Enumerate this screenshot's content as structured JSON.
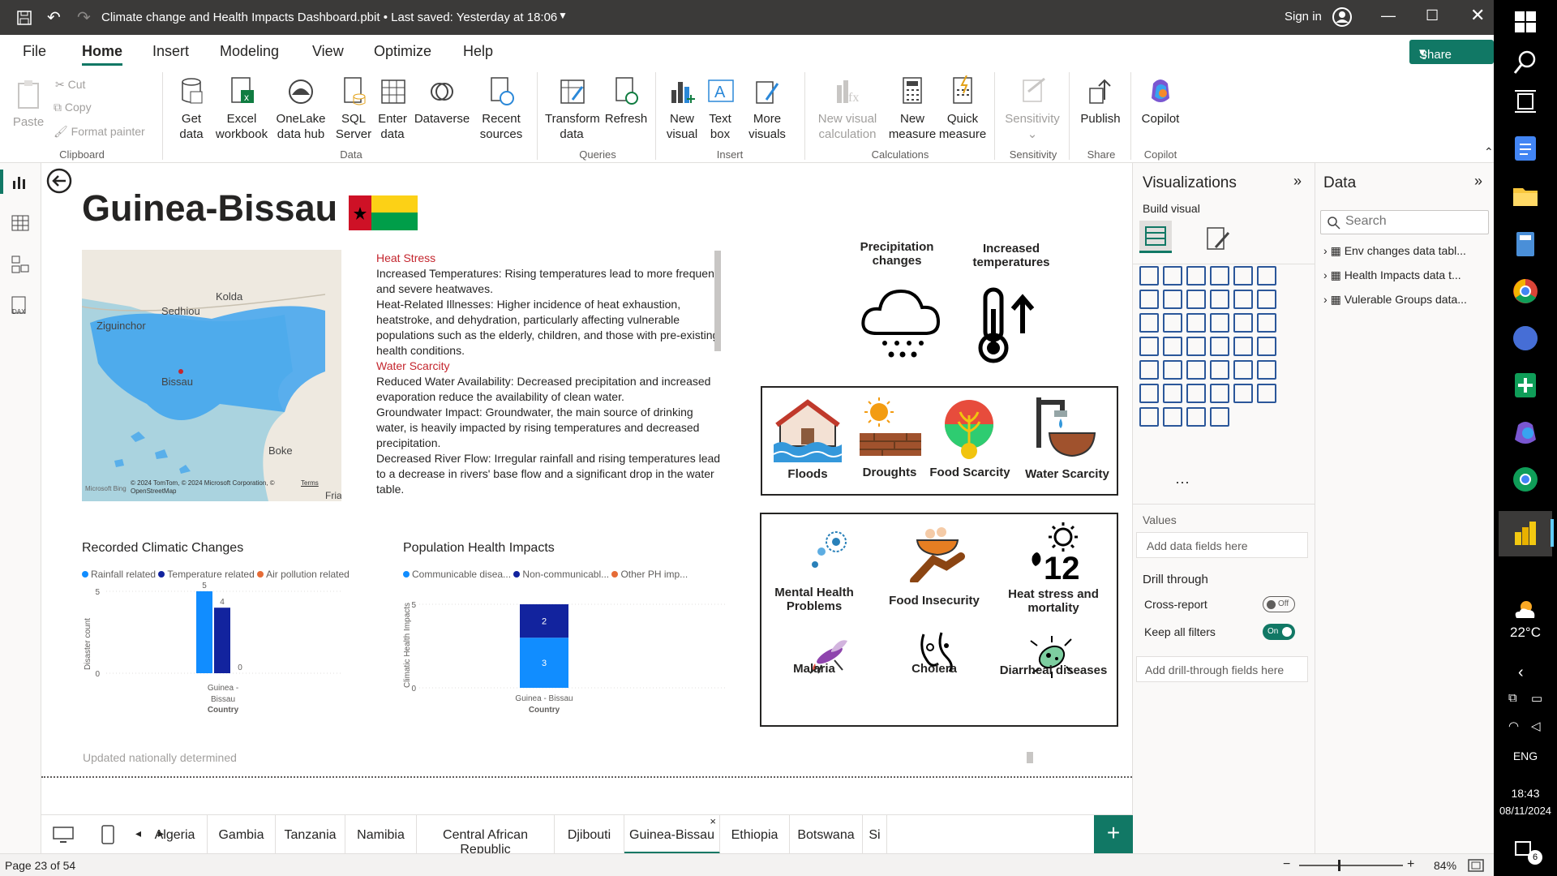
{
  "window": {
    "title": "Climate change and Health Impacts Dashboard.pbit  •  Last saved: Yesterday at 18:06",
    "sign_in": "Sign in"
  },
  "menu": {
    "file": "File",
    "home": "Home",
    "insert": "Insert",
    "modeling": "Modeling",
    "view": "View",
    "optimize": "Optimize",
    "help": "Help",
    "share": "Share"
  },
  "ribbon": {
    "paste": "Paste",
    "cut": "Cut",
    "copy": "Copy",
    "format_painter": "Format painter",
    "clipboard": "Clipboard",
    "get_data": "Get data",
    "excel": "Excel workbook",
    "onelake": "OneLake data hub",
    "sql": "SQL Server",
    "enter_data": "Enter data",
    "dataverse": "Dataverse",
    "recent": "Recent sources",
    "data_group": "Data",
    "transform": "Transform data",
    "refresh": "Refresh",
    "queries": "Queries",
    "new_visual": "New visual",
    "text_box": "Text box",
    "more_visuals": "More visuals",
    "insert_group": "Insert",
    "new_visual_calc": "New visual calculation",
    "new_measure": "New measure",
    "quick_measure": "Quick measure",
    "calculations": "Calculations",
    "sensitivity": "Sensitivity",
    "sensitivity_group": "Sensitivity",
    "publish": "Publish",
    "share_group": "Share",
    "copilot": "Copilot",
    "copilot_group": "Copilot"
  },
  "report": {
    "country": "Guinea-Bissau",
    "map_labels": {
      "kolda": "Kolda",
      "sedhiou": "Sedhiou",
      "ziguinchor": "Ziguinchor",
      "bissau": "Bissau",
      "boke": "Boke",
      "fria": "Fria"
    },
    "map_copyright": "© 2024 TomTom, © 2024 Microsoft Corporation, © OpenStreetMap",
    "map_terms": "Terms",
    "map_brand": "Microsoft Bing",
    "text": {
      "h1": "Heat Stress",
      "p1": "Increased Temperatures: Rising temperatures lead to more frequent and severe heatwaves.",
      "p2": "Heat-Related Illnesses: Higher incidence of heat exhaustion, heatstroke, and dehydration, particularly affecting vulnerable populations such as the elderly, children, and those with pre-existing health conditions.",
      "h2": "Water Scarcity",
      "p3": "Reduced Water Availability: Decreased precipitation and increased evaporation reduce the availability of clean water.",
      "p4": "Groundwater Impact: Groundwater, the main source of drinking water, is heavily impacted by rising temperatures and decreased precipitation.",
      "p5": "Decreased River Flow: Irregular rainfall and rising temperatures lead to a decrease in rivers' base flow and a significant drop in the water table."
    },
    "icons_top": {
      "precip": "Precipitation changes",
      "temps": "Increased temperatures"
    },
    "hazards": {
      "floods": "Floods",
      "droughts": "Droughts",
      "food": "Food Scarcity",
      "water": "Water Scarcity"
    },
    "health": {
      "mental": "Mental Health Problems",
      "food_insec": "Food Insecurity",
      "heat": "Heat stress and mortality",
      "malaria": "Malaria",
      "cholera": "Cholera",
      "diarrheal": "Diarrheal diseases"
    },
    "footer_note": "Updated nationally determined"
  },
  "chart_data": [
    {
      "type": "bar",
      "title": "Recorded Climatic Changes",
      "categories": [
        "Guinea - Bissau"
      ],
      "series": [
        {
          "name": "Rainfall related",
          "values": [
            5
          ],
          "color": "#118dff"
        },
        {
          "name": "Temperature related",
          "values": [
            4
          ],
          "color": "#12239e"
        },
        {
          "name": "Air pollution related",
          "values": [
            0
          ],
          "color": "#e66c37"
        }
      ],
      "xlabel": "Country",
      "ylabel": "Disaster count",
      "yticks": [
        "0",
        "5"
      ],
      "ylim": [
        0,
        5
      ]
    },
    {
      "type": "bar",
      "stacked": true,
      "title": "Population Health Impacts",
      "categories": [
        "Guinea - Bissau"
      ],
      "series": [
        {
          "name": "Communicable disea...",
          "values": [
            3
          ],
          "color": "#118dff"
        },
        {
          "name": "Non-communicabl...",
          "values": [
            2
          ],
          "color": "#12239e"
        },
        {
          "name": "Other PH imp...",
          "values": [
            0
          ],
          "color": "#e66c37"
        }
      ],
      "xlabel": "Country",
      "ylabel": "Climatic Health Impacts",
      "yticks": [
        "0",
        "5"
      ],
      "ylim": [
        0,
        5
      ]
    }
  ],
  "viz": {
    "title": "Visualizations",
    "build": "Build visual",
    "values": "Values",
    "add_fields": "Add data fields here",
    "drill": "Drill through",
    "cross": "Cross-report",
    "cross_state": "Off",
    "keep": "Keep all filters",
    "keep_state": "On",
    "add_drill": "Add drill-through fields here"
  },
  "data_pane": {
    "title": "Data",
    "search_placeholder": "Search",
    "tables": [
      "Env changes data tabl...",
      "Health Impacts data t...",
      "Vulerable Groups data..."
    ]
  },
  "tabs": [
    "Algeria",
    "Gambia",
    "Tanzania",
    "Namibia",
    "Central African Republic",
    "Djibouti",
    "Guinea-Bissau",
    "Ethiopia",
    "Botswana",
    "Si"
  ],
  "status": {
    "page": "Page 23 of 54",
    "zoom": "84%"
  },
  "taskbar": {
    "temp": "22°C",
    "lang": "ENG",
    "time": "18:43",
    "date": "08/11/2024",
    "notif": "6"
  }
}
